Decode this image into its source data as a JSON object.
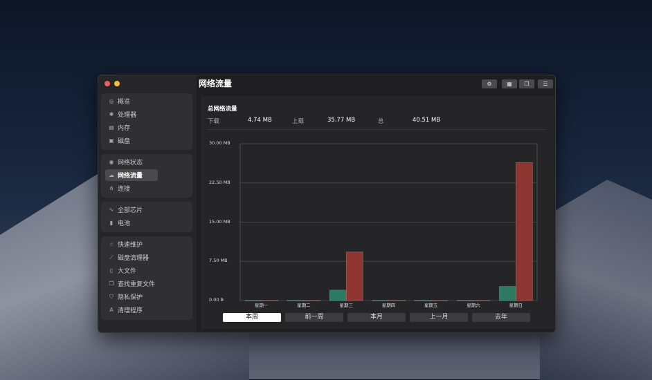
{
  "window": {
    "title": "网络流量"
  },
  "toolbar": [
    {
      "name": "settings-icon",
      "glyph": "⚙"
    },
    {
      "name": "grid-view-icon",
      "glyph": "▦"
    },
    {
      "name": "copy-icon",
      "glyph": "❐"
    },
    {
      "name": "list-view-icon",
      "glyph": "☰"
    }
  ],
  "sidebar": {
    "groups": [
      {
        "items": [
          {
            "label": "概览",
            "icon": "gauge-icon",
            "glyph": "◎"
          },
          {
            "label": "处理器",
            "icon": "cpu-icon",
            "glyph": "✱"
          },
          {
            "label": "内存",
            "icon": "memory-icon",
            "glyph": "▤"
          },
          {
            "label": "磁盘",
            "icon": "disk-icon",
            "glyph": "▣"
          }
        ]
      },
      {
        "items": [
          {
            "label": "网络状态",
            "icon": "globe-icon",
            "glyph": "◉"
          },
          {
            "label": "网络流量",
            "icon": "cloud-icon",
            "glyph": "☁",
            "active": true
          },
          {
            "label": "连接",
            "icon": "network-tree-icon",
            "glyph": "⋔"
          }
        ]
      },
      {
        "items": [
          {
            "label": "全部芯片",
            "icon": "pulse-icon",
            "glyph": "∿"
          },
          {
            "label": "电池",
            "icon": "battery-icon",
            "glyph": "▮"
          }
        ]
      },
      {
        "items": [
          {
            "label": "快速维护",
            "icon": "hand-icon",
            "glyph": "☝"
          },
          {
            "label": "磁盘清理器",
            "icon": "broom-icon",
            "glyph": "⟋"
          },
          {
            "label": "大文件",
            "icon": "document-icon",
            "glyph": "▯"
          },
          {
            "label": "查找重复文件",
            "icon": "duplicate-icon",
            "glyph": "❐"
          },
          {
            "label": "隐私保护",
            "icon": "shield-icon",
            "glyph": "⛉"
          },
          {
            "label": "清理程序",
            "icon": "app-icon",
            "glyph": "A"
          }
        ]
      }
    ]
  },
  "summary": {
    "title": "总网络流量",
    "download_label": "下载",
    "download_value": "4.74 MB",
    "upload_label": "上载",
    "upload_value": "35.77 MB",
    "total_label": "总",
    "total_value": "40.51 MB"
  },
  "chart_data": {
    "type": "bar",
    "categories": [
      "星期一",
      "星期二",
      "星期三",
      "星期四",
      "星期五",
      "星期六",
      "星期日"
    ],
    "series": [
      {
        "name": "",
        "color": "#2f7a63",
        "values": [
          0.05,
          0.05,
          2.0,
          0.05,
          0.05,
          0.05,
          2.7
        ]
      },
      {
        "name": "",
        "color": "#8e3631",
        "values": [
          0.05,
          0.05,
          9.3,
          0.05,
          0.05,
          0.05,
          26.4
        ]
      }
    ],
    "ylim": [
      0,
      30
    ],
    "ytick_labels": [
      "0.00 B",
      "7.50 MB",
      "15.00 MB",
      "22.50 MB",
      "30.00 MB"
    ],
    "grid": true
  },
  "periods": [
    {
      "label": "本周",
      "active": true
    },
    {
      "label": "前一周"
    },
    {
      "label": "本月"
    },
    {
      "label": "上一月"
    },
    {
      "label": "去年"
    }
  ]
}
